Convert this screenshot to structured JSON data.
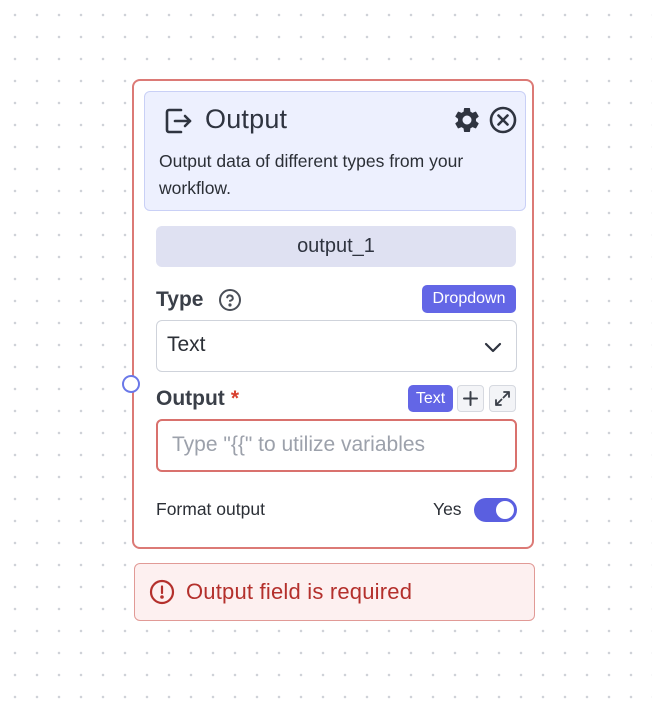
{
  "node": {
    "title": "Output",
    "icon": "output-exit-icon",
    "description": "Output data of different types from your workflow.",
    "name": "output_1",
    "colors": {
      "border": "#dc7a76",
      "header_bg": "#edf0fe",
      "accent": "#6366e6"
    }
  },
  "fields": {
    "type": {
      "label": "Type",
      "badge": "Dropdown",
      "value": "Text"
    },
    "output": {
      "label": "Output",
      "required_marker": "*",
      "badge": "Text",
      "placeholder": "Type \"{{\" to utilize variables"
    },
    "format_output": {
      "label": "Format output",
      "value_label": "Yes",
      "enabled": true
    }
  },
  "error": {
    "message": "Output field is required",
    "color": "#b4302c"
  }
}
